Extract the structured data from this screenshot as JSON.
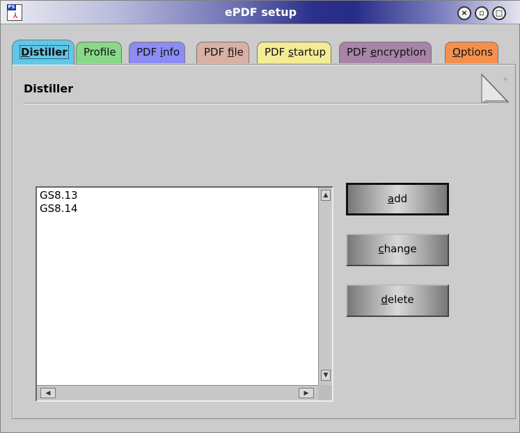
{
  "window": {
    "title": "ePDF setup"
  },
  "tabs": [
    {
      "label": "Distiller",
      "underline": "D",
      "rest": "istiller",
      "color": "#5fc8e8"
    },
    {
      "label": "Profile",
      "underline": "",
      "rest": "Profile",
      "color": "#88d888"
    },
    {
      "label": "PDF info",
      "pre": "PDF ",
      "underline": "i",
      "rest": "nfo",
      "color": "#8c8cf4"
    },
    {
      "label": "PDF file",
      "pre": "PDF ",
      "underline": "f",
      "rest": "ile",
      "color": "#d9b0a4"
    },
    {
      "label": "PDF startup",
      "pre": "PDF ",
      "underline": "s",
      "rest": "tartup",
      "color": "#f4ec94"
    },
    {
      "label": "PDF encryption",
      "pre": "PDF ",
      "underline": "e",
      "rest": "ncryption",
      "color": "#a884a8"
    },
    {
      "label": "Options",
      "underline": "O",
      "rest": "ptions",
      "color": "#f4904c"
    }
  ],
  "panel": {
    "title": "Distiller"
  },
  "distiller_list": {
    "items": [
      "GS8.13",
      "GS8.14"
    ]
  },
  "buttons": {
    "add": {
      "label": "add",
      "underline": "a",
      "rest": "dd"
    },
    "change": {
      "label": "change",
      "underline": "c",
      "rest": "hange"
    },
    "delete": {
      "label": "delete",
      "underline": "d",
      "rest": "elete"
    }
  },
  "icons": {
    "window_icon": "ps-pdf-icon",
    "close": "close-icon",
    "minimize": "minimize-icon",
    "maximize": "maximize-icon"
  }
}
